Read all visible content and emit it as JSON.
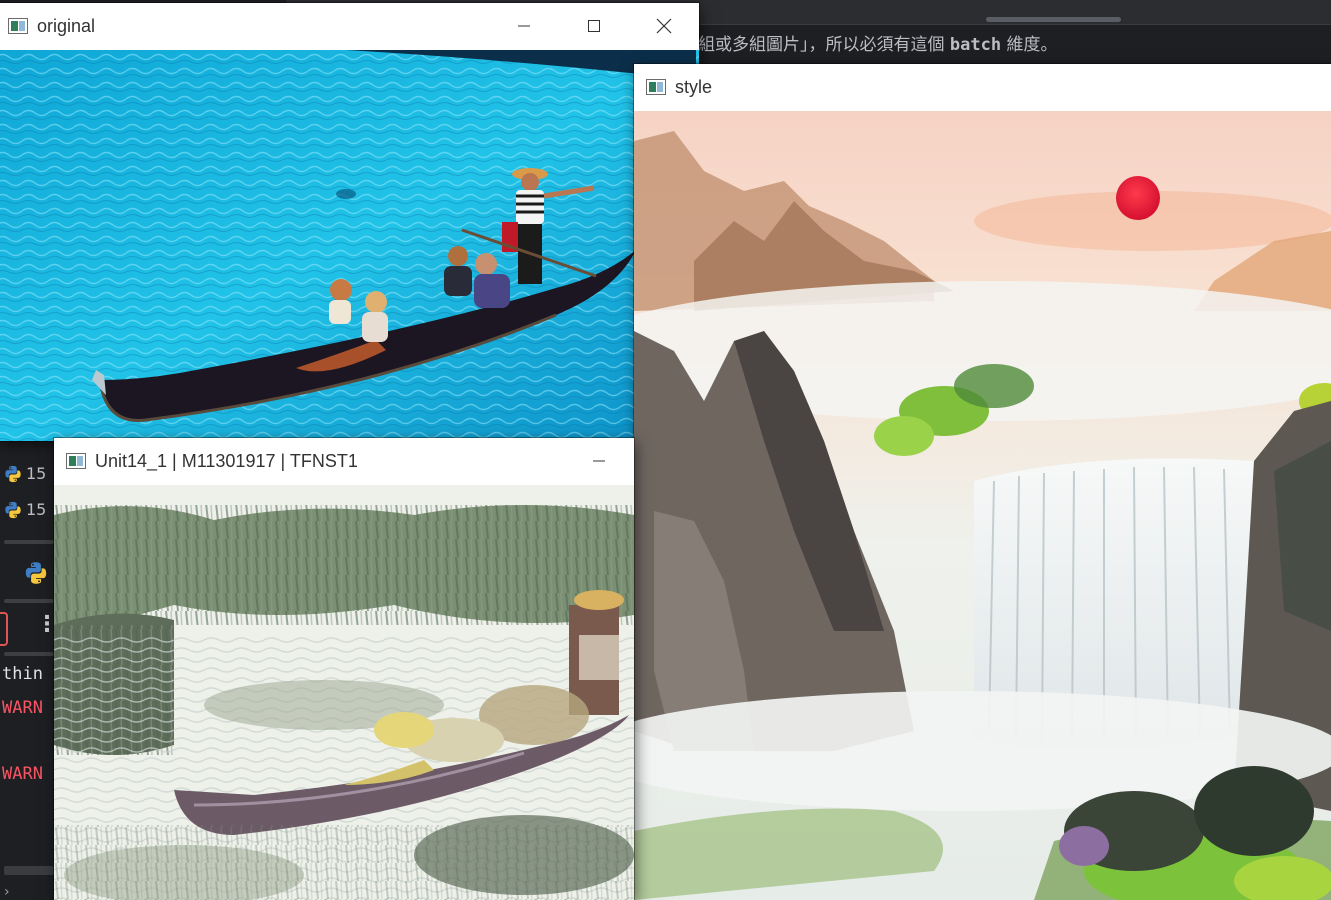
{
  "ide": {
    "doc_text_prefix": "組或多組圖片」，所以必須有這個",
    "doc_text_code": "batch",
    "doc_text_suffix": "維度。",
    "line_numbers": [
      "15",
      "15"
    ],
    "console_think": "thin",
    "console_warn_1": "WARN",
    "console_warn_2": "WARN"
  },
  "windows": {
    "original": {
      "title": "original"
    },
    "style": {
      "title": "style"
    },
    "result": {
      "title": "Unit14_1 | M11301917 | TFNST1"
    }
  },
  "icons": {
    "title_icon": "app-window-icon",
    "minimize": "minimize-icon",
    "maximize": "maximize-icon",
    "close": "close-icon",
    "python": "python-icon",
    "kebab": "more-vertical-icon"
  },
  "colors": {
    "pool_water": "#17b6dc",
    "sun": "#e8203a",
    "warning_text": "#f75464"
  }
}
